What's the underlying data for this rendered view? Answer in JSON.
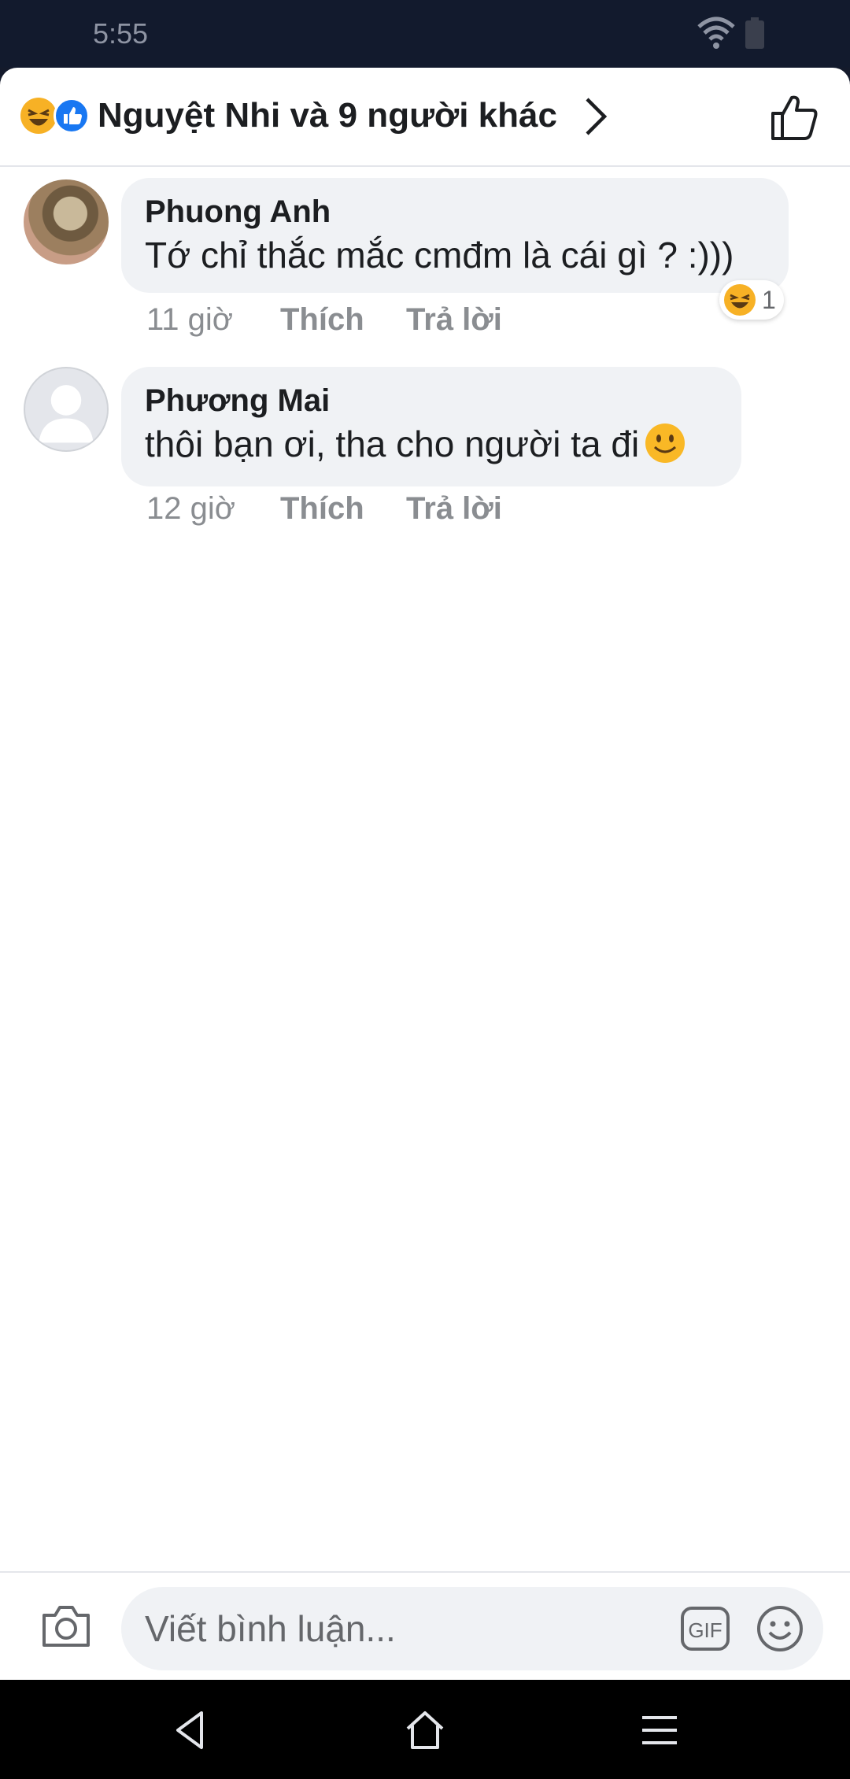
{
  "status_bar": {
    "time": "5:55"
  },
  "reactions_header": {
    "title": "Nguyệt Nhi và 9 người khác"
  },
  "comments": [
    {
      "author": "Phuong Anh",
      "text": "Tớ chỉ thắc mắc cmđm là cái gì ? :)))",
      "time": "11 giờ",
      "like_label": "Thích",
      "reply_label": "Trả lời",
      "reaction_count": "1"
    },
    {
      "author": "Phương Mai",
      "text": "thôi bạn ơi, tha cho người ta đi",
      "time": "12 giờ",
      "like_label": "Thích",
      "reply_label": "Trả lời"
    }
  ],
  "composer": {
    "placeholder": "Viết bình luận...",
    "gif_label": "GIF"
  },
  "colors": {
    "sheet": "#ffffff",
    "bubble": "#f0f2f5",
    "like_blue": "#1877f2",
    "haha_yellow": "#f7b125",
    "meta_gray": "#8a8d91"
  }
}
